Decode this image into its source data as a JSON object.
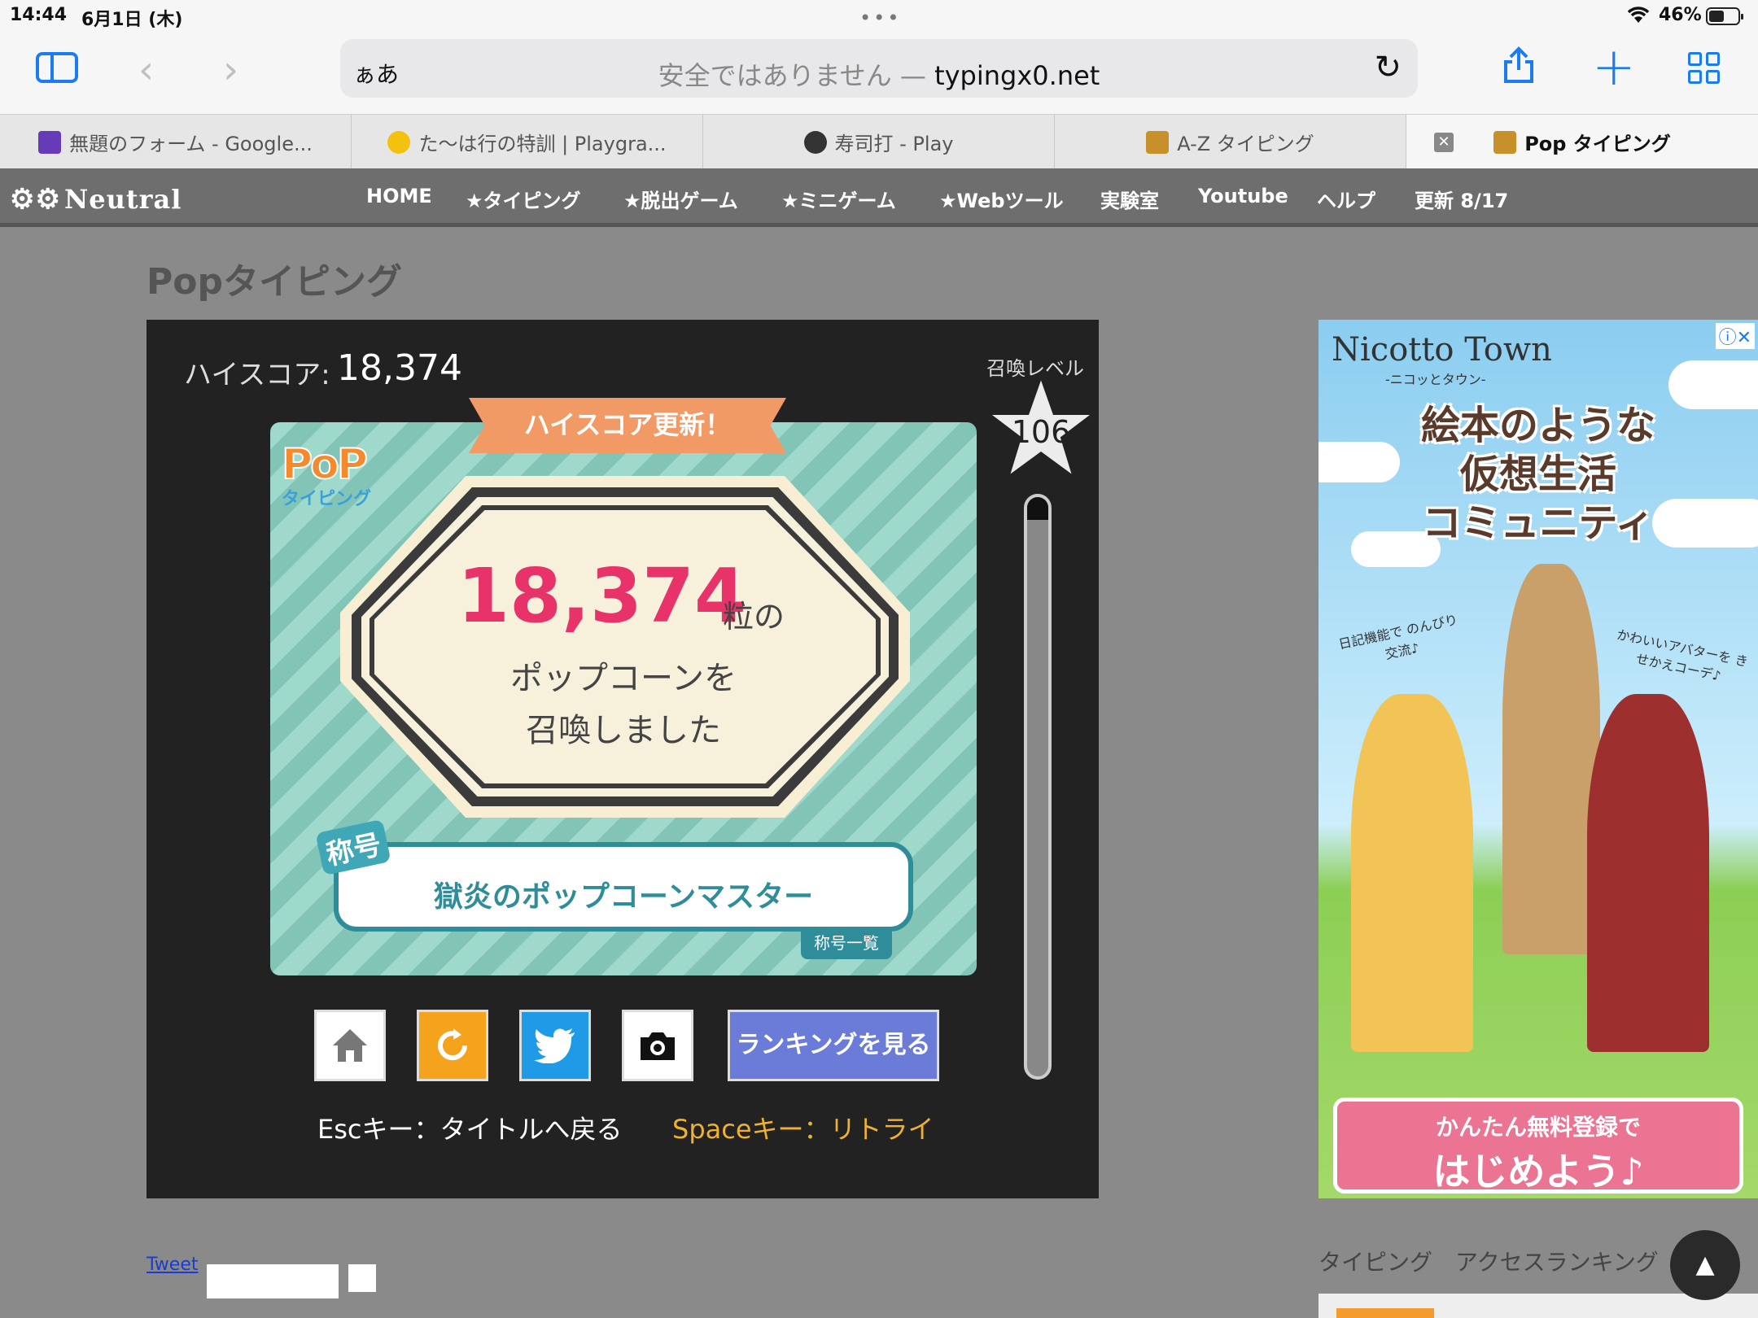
{
  "status": {
    "time": "14:44",
    "date": "6月1日 (木)",
    "battery": "46%",
    "dots": "•••"
  },
  "toolbar": {
    "aa": "ぁあ",
    "insecure": "安全ではありません —",
    "domain": "typingx0.net"
  },
  "tabs": [
    {
      "label": "無題のフォーム - Google...",
      "color": "#673ab7"
    },
    {
      "label": "た〜は行の特訓 | Playgra...",
      "color": "#f3c20e"
    },
    {
      "label": "寿司打 - Play",
      "color": "#333333"
    },
    {
      "label": "A-Z タイピング",
      "color": "#c8902a"
    },
    {
      "label": "Pop タイピング",
      "color": "#c8902a"
    }
  ],
  "site": {
    "logo": "Neutral",
    "nav": [
      "HOME",
      "★タイピング",
      "★脱出ゲーム",
      "★ミニゲーム",
      "★Webツール",
      "実験室",
      "Youtube",
      "ヘルプ",
      "更新 8/17"
    ]
  },
  "page": {
    "title": "Popタイピング"
  },
  "game": {
    "highscore_label": "ハイスコア:",
    "highscore_value": "18,374",
    "level_label": "召喚レベル",
    "level_value": "106",
    "gauge_fill": 0.04,
    "banner": "ハイスコア更新！",
    "logo_pop": "PoP",
    "logo_sub": "タイピング",
    "score_value": "18,374",
    "score_unit": "粒の",
    "score_line2": "ポップコーンを",
    "score_line3": "召喚しました",
    "title_badge": "称号",
    "title_text": "獄炎のポップコーンマスター",
    "title_list": "称号一覧",
    "ranking_btn": "ランキングを見る",
    "esc_hint": "Escキー：タイトルへ戻る",
    "space_hint": "Spaceキー：リトライ"
  },
  "ad": {
    "brand": "Nicotto Town",
    "brand_sub": "-ニコッとタウン-",
    "line1": "絵本のような",
    "line2": "仮想生活",
    "line3": "コミュニティ",
    "bubble_left": "日記機能で のんびり交流♪",
    "bubble_right": "かわいいアバターを きせかえコーデ♪",
    "cta1": "かんたん無料登録で",
    "cta2": "はじめよう♪"
  },
  "footer": {
    "tweet": "Tweet",
    "side_title": "タイピング　アクセスランキング",
    "top_btn": "▲"
  }
}
